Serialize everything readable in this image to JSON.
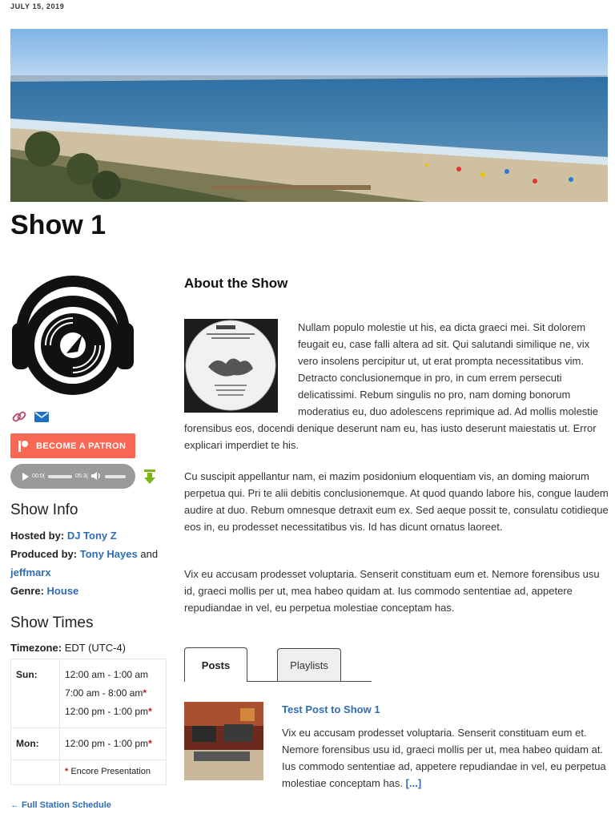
{
  "post": {
    "date": "JULY 15, 2019"
  },
  "show": {
    "title": "Show 1"
  },
  "side": {
    "patron_label": "BECOME A PATRON",
    "player": {
      "current": "00:0(",
      "duration": "05:3("
    },
    "info_heading": "Show Info",
    "hosted_label": "Hosted by",
    "hosted_by": "DJ Tony Z",
    "produced_label": "Produced by",
    "producer_1": "Tony Hayes",
    "and_word": "and",
    "producer_2": "jeffmarx",
    "genre_label": "Genre",
    "genre": "House",
    "times_heading": "Show Times",
    "timezone_label": "Timezone",
    "timezone": "EDT (UTC-4)",
    "schedule": [
      {
        "day": "Sun:",
        "slots": [
          {
            "time": "12:00 am - 1:00 am",
            "encore": false
          },
          {
            "time": "7:00 am - 8:00 am",
            "encore": true
          },
          {
            "time": "12:00 pm - 1:00 pm",
            "encore": true
          }
        ]
      },
      {
        "day": "Mon:",
        "slots": [
          {
            "time": "12:00 pm - 1:00 pm",
            "encore": true
          }
        ]
      }
    ],
    "encore_star": "*",
    "encore_label": "Encore Presentation",
    "full_schedule": "← Full Station Schedule"
  },
  "about": {
    "heading": "About the Show",
    "p1": "Nullam populo molestie ut his, ea dicta graeci mei. Sit dolorem feugait eu, case falli altera ad sit. Qui salutandi similique ne, vix vero insolens percipitur ut, ut erat prompta necessitatibus vim. Detracto conclusionemque in pro, in cum errem persecuti delicatissimi. Rebum singulis no pro, nam doming bonorum moderatius eu, duo adolescens reprimique ad. Ad mollis molestie forensibus eos, docendi denique deserunt nam eu, has iusto deserunt maiestatis ut. Error explicari imperdiet te his.",
    "p2": "Cu suscipit appellantur nam, ei mazim posidonium eloquentiam vis, an doming maiorum perpetua qui. Pri te alii debitis conclusionemque. At quod quando labore his, congue laudem audire at duo. Rebum omnesque detraxit eum ex. Sed aeque possit te, consulatu cotidieque eos in, eu prodesset necessitatibus vis. Id has dicunt ornatus laoreet.",
    "p3": "Vix eu accusam prodesset voluptaria. Senserit constituam eum et. Nemore forensibus usu id, graeci mollis per ut, mea habeo quidam at. Ius commodo sententiae ad, appetere repudiandae in vel, eu perpetua molestiae conceptam has."
  },
  "tabs": [
    {
      "label": "Posts",
      "active": true
    },
    {
      "label": "Playlists",
      "active": false
    }
  ],
  "recent_post": {
    "title": "Test Post to Show 1",
    "excerpt": "Vix eu accusam prodesset voluptaria. Senserit constituam eum et. Nemore forensibus usu id, graeci mollis per ut, mea habeo quidam at. Ius commodo sententiae ad, appetere repudiandae in vel, eu perpetua molestiae conceptam has.",
    "more": "[...]"
  },
  "icons": [
    "link-icon",
    "email-icon",
    "download-icon",
    "volume-icon",
    "play-icon"
  ],
  "colors": {
    "link": "#2e6db4",
    "patron": "#f96854",
    "star": "#c0161b",
    "download": "#7cb518"
  }
}
